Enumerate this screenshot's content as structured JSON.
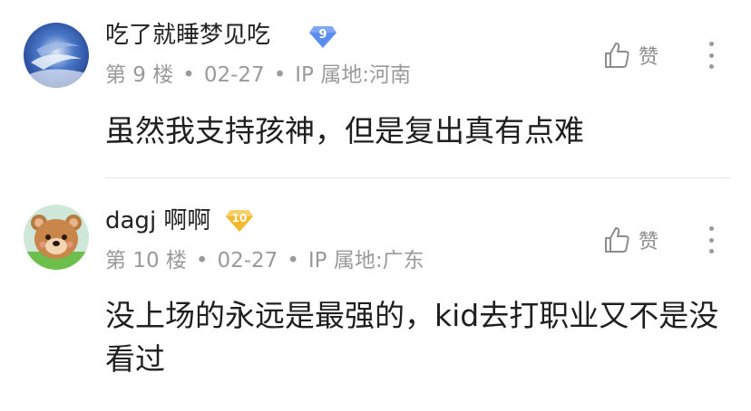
{
  "posts": [
    {
      "username": "吃了就睡梦见吃",
      "level": "9",
      "floor": "第 9 楼",
      "date": "02-27",
      "ip": "IP 属地:河南",
      "like_label": "赞",
      "content": "虽然我支持孩神，但是复出真有点难",
      "badge_color": "#5b8def"
    },
    {
      "username": "dagj 啊啊",
      "level": "10",
      "floor": "第 10 楼",
      "date": "02-27",
      "ip": "IP 属地:广东",
      "like_label": "赞",
      "content": "没上场的永远是最强的，kid去打职业又不是没看过",
      "badge_color": "#f2b92d"
    }
  ],
  "meta_dot": "•"
}
